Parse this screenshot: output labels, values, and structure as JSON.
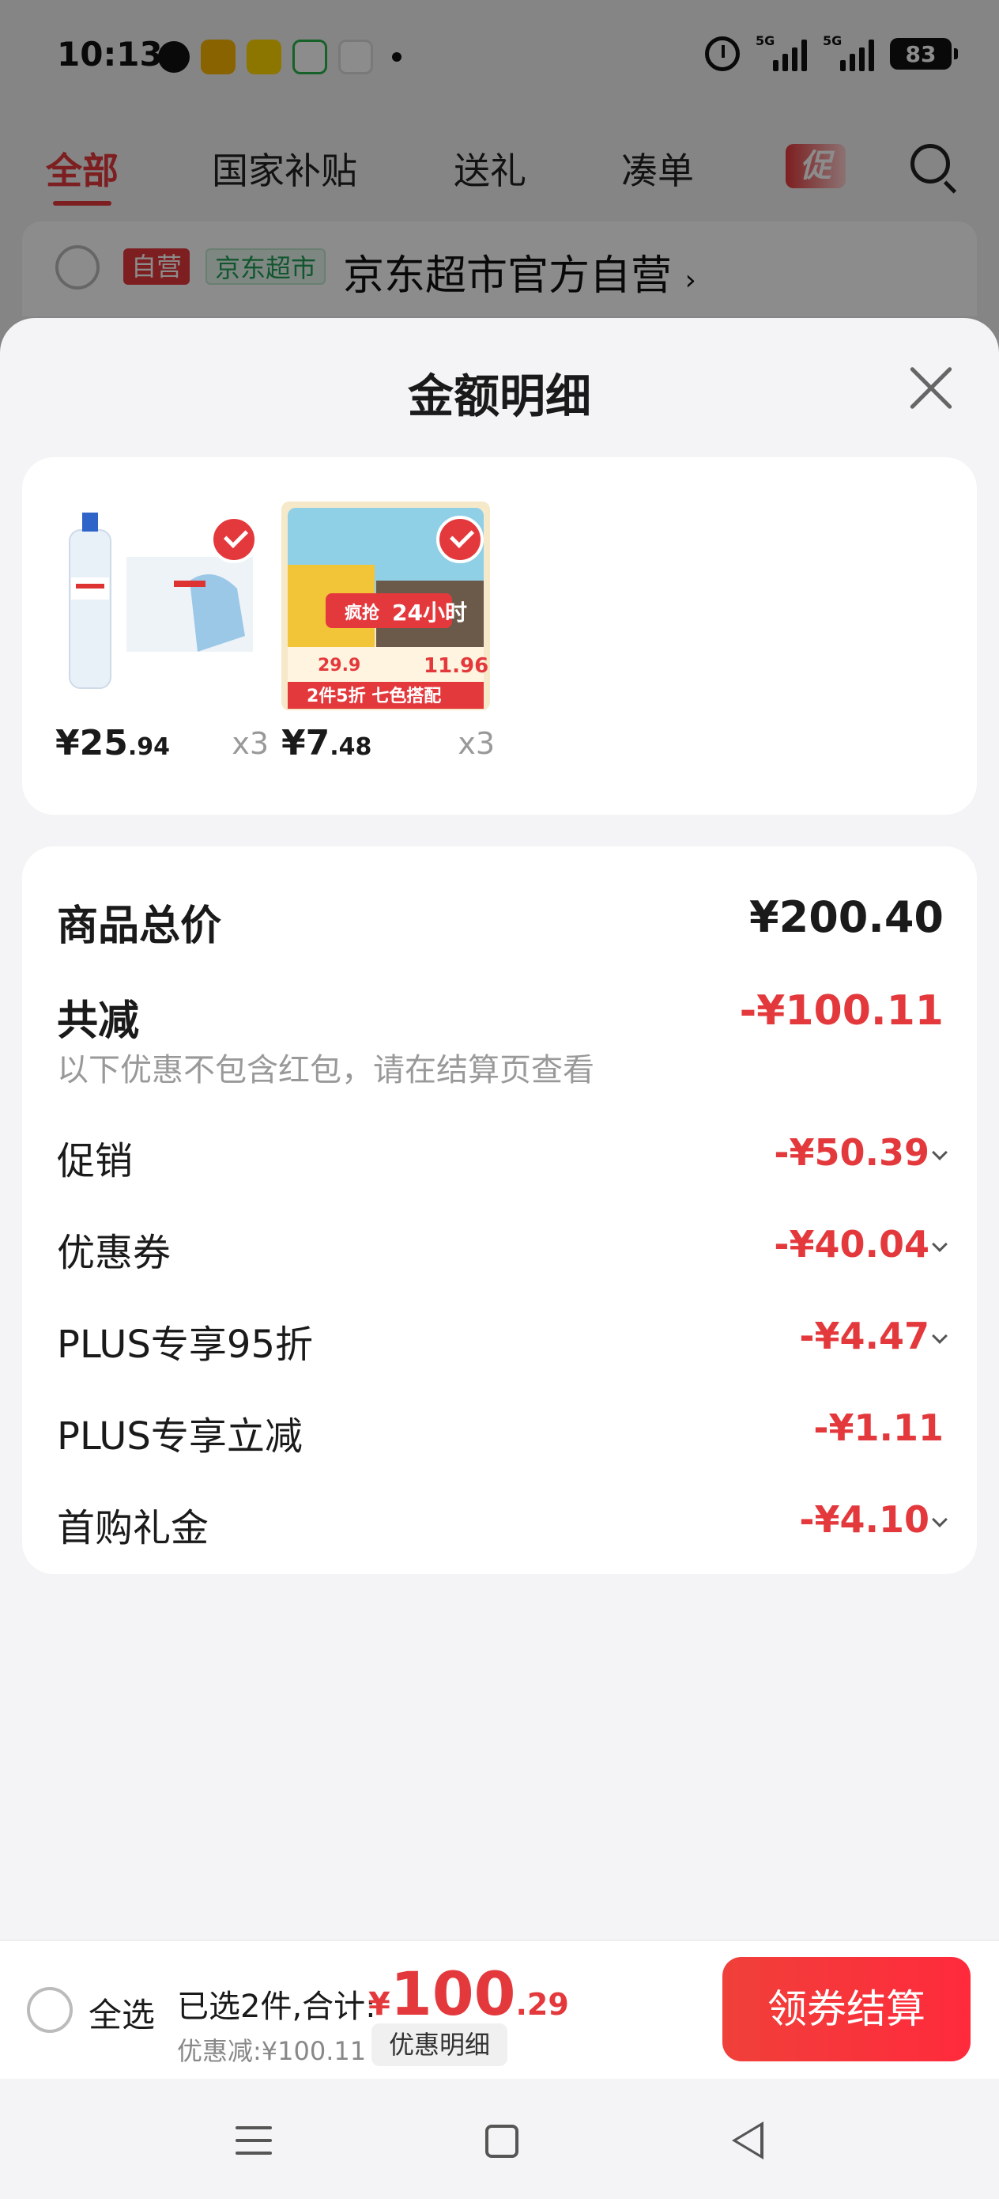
{
  "status_bar": {
    "time": "10:13",
    "network_1": "5G",
    "network_2": "5G",
    "battery": "83"
  },
  "background": {
    "tabs": [
      "全部",
      "国家补贴",
      "送礼",
      "凑单"
    ],
    "promo_chip": "促",
    "store_badge_self": "自营",
    "store_badge_jd": "京东超市",
    "store_name": "京东超市官方自营",
    "store_chevron": "›"
  },
  "sheet": {
    "title": "金额明细",
    "products": [
      {
        "price_int": "¥25",
        "price_cents": ".94",
        "qty": "x3",
        "thumb_icon": "water-bottle-icon"
      },
      {
        "price_int": "¥7",
        "price_cents": ".48",
        "qty": "x3",
        "thumb_icon": "sunflower-seeds-icon",
        "thumb_text_1": "2件5折 七色搭配",
        "thumb_text_2": "24小时",
        "thumb_text_3": "29.9",
        "thumb_text_4": "11.96"
      }
    ],
    "summary": {
      "total_label": "商品总价",
      "total_value": "¥200.40",
      "reduce_label": "共减",
      "reduce_value": "-¥100.11",
      "note": "以下优惠不包含红包，请在结算页查看"
    },
    "discounts": [
      {
        "label": "促销",
        "value": "-¥50.39",
        "expandable": true
      },
      {
        "label": "优惠券",
        "value": "-¥40.04",
        "expandable": true
      },
      {
        "label": "PLUS专享95折",
        "value": "-¥4.47",
        "expandable": true
      },
      {
        "label": "PLUS专享立减",
        "value": "-¥1.11",
        "expandable": false
      },
      {
        "label": "首购礼金",
        "value": "-¥4.10",
        "expandable": true
      }
    ]
  },
  "bottom_bar": {
    "select_all": "全选",
    "selected_text": "已选2件,合计:",
    "total_yen": "¥",
    "total_int": "100",
    "total_cents": ".29",
    "discount_text": "优惠减:¥100.11",
    "detail_button": "优惠明细",
    "checkout_button": "领券结算"
  },
  "colors": {
    "accent": "#e4393c",
    "jd_green": "#1f9d55",
    "sheet_bg": "#f4f4f6"
  }
}
